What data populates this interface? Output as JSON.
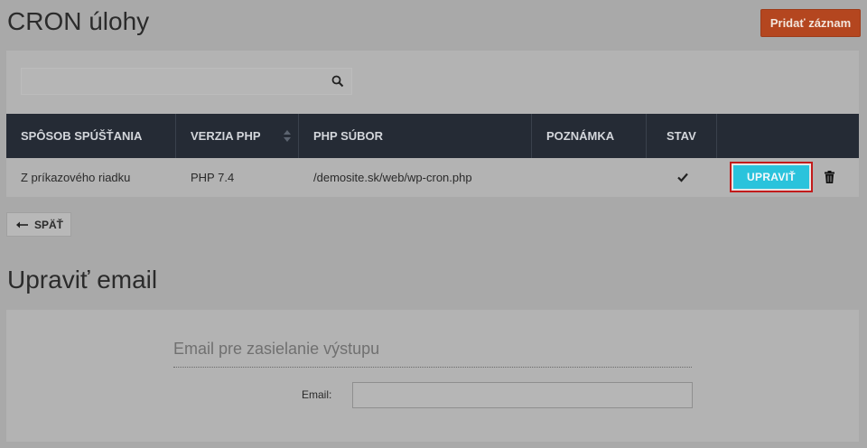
{
  "header": {
    "title": "CRON úlohy",
    "add_button": "Pridať záznam"
  },
  "search": {
    "value": "",
    "placeholder": ""
  },
  "table": {
    "columns": [
      "SPÔSOB SPÚŠŤANIA",
      "VERZIA PHP",
      "PHP SÚBOR",
      "POZNÁMKA",
      "STAV",
      ""
    ],
    "rows": [
      {
        "mode": "Z príkazového riadku",
        "php_version": "PHP 7.4",
        "php_file": "/demosite.sk/web/wp-cron.php",
        "note": "",
        "status": "enabled",
        "edit_label": "UPRAVIŤ"
      }
    ]
  },
  "back_button": "SPÄŤ",
  "email_section": {
    "title": "Upraviť email",
    "legend": "Email pre zasielanie výstupu",
    "email_label": "Email:",
    "email_value": ""
  },
  "colors": {
    "accent_add": "#b4461f",
    "edit_button": "#2ac3dc",
    "table_header": "#252b35"
  }
}
